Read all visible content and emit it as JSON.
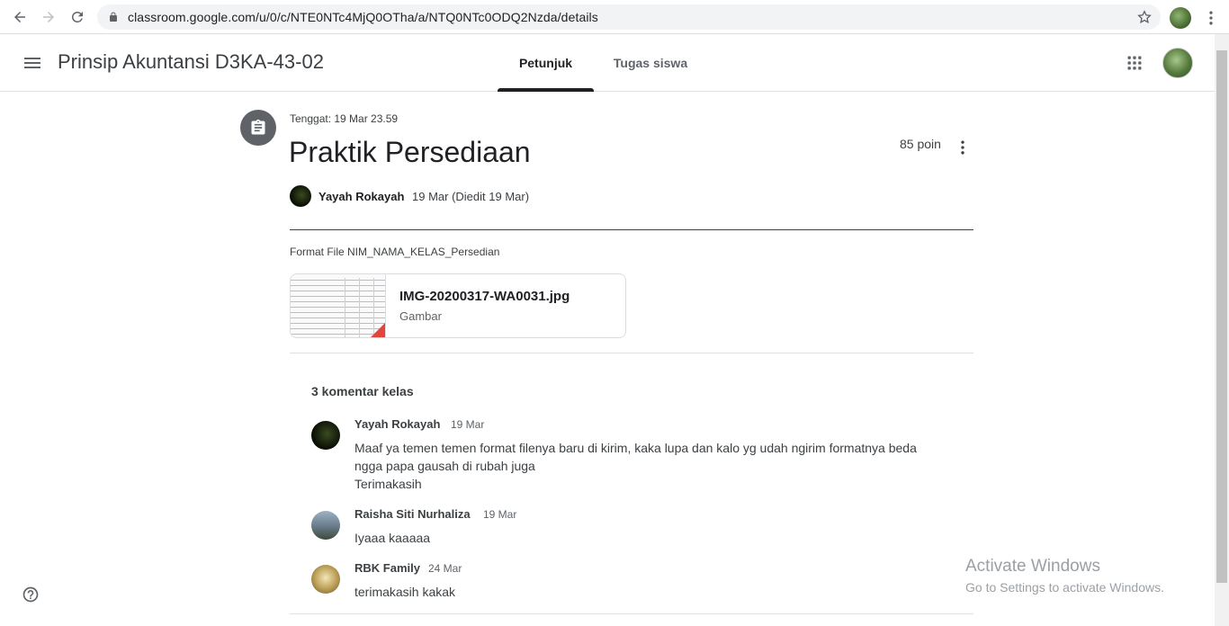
{
  "browser": {
    "url": "classroom.google.com/u/0/c/NTE0NTc4MjQ0OTha/a/NTQ0NTc0ODQ2Nzda/details"
  },
  "header": {
    "class_title": "Prinsip Akuntansi D3KA-43-02",
    "tabs": [
      {
        "label": "Petunjuk",
        "active": true
      },
      {
        "label": "Tugas siswa",
        "active": false
      }
    ]
  },
  "assignment": {
    "due": "Tenggat: 19 Mar 23.59",
    "title": "Praktik Persediaan",
    "points": "85 poin",
    "author": "Yayah Rokayah",
    "posted": "19 Mar (Diedit 19 Mar)",
    "instructions": "Format File NIM_NAMA_KELAS_Persedian",
    "attachment": {
      "name": "IMG-20200317-WA0031.jpg",
      "type": "Gambar"
    }
  },
  "comments": {
    "heading": "3 komentar kelas",
    "items": [
      {
        "author": "Yayah Rokayah",
        "date": "19 Mar",
        "lines": [
          "Maaf ya temen temen format filenya baru di kirim, kaka lupa dan kalo yg udah ngirim formatnya beda",
          "ngga papa gausah di rubah juga",
          "Terimakasih"
        ]
      },
      {
        "author": "Raisha Siti Nurhaliza",
        "date": "19 Mar",
        "lines": [
          "Iyaaa kaaaaa"
        ]
      },
      {
        "author": "RBK Family",
        "date": "24 Mar",
        "lines": [
          "terimakasih kakak"
        ]
      }
    ]
  },
  "watermark": {
    "title": "Activate Windows",
    "subtitle": "Go to Settings to activate Windows."
  },
  "icons": {
    "back": "arrow-left-icon",
    "forward": "arrow-right-icon",
    "reload": "reload-icon",
    "lock": "lock-icon",
    "bookmark": "star-icon",
    "menu": "hamburger-icon",
    "apps": "apps-grid-icon",
    "assignment": "assignment-icon",
    "more": "more-vert-icon",
    "help": "help-icon"
  }
}
